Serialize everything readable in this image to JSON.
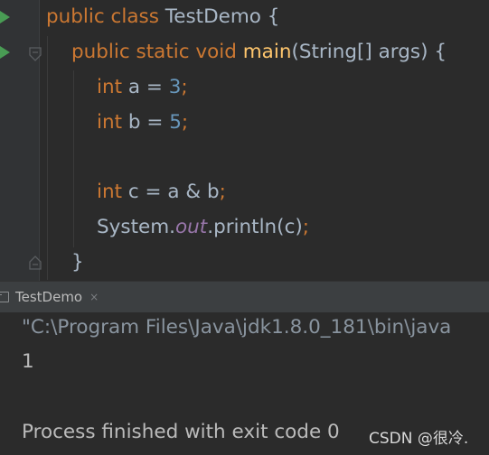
{
  "editor": {
    "lines": [
      {
        "kw1": "public class ",
        "name": "TestDemo {"
      },
      {
        "kw1": "public static void ",
        "fn": "main",
        "rest": "(String[] args) {"
      },
      {
        "kw1": "int ",
        "rest": "a = ",
        "num": "3",
        "punc": ";"
      },
      {
        "kw1": "int ",
        "rest": "b = ",
        "num": "5",
        "punc": ";"
      },
      {
        "kw1": "int ",
        "rest": "c = a & b",
        "punc": ";"
      },
      {
        "a": "System.",
        "fld": "out",
        "b": ".println(c)",
        "punc": ";"
      },
      {
        "rest": "}"
      }
    ]
  },
  "tool_window": {
    "tab_label": "TestDemo",
    "tab_close": "×"
  },
  "console": {
    "command": "\"C:\\Program Files\\Java\\jdk1.8.0_181\\bin\\java",
    "output": "1",
    "finished": "Process finished with exit code 0"
  },
  "watermark": "CSDN @很冷."
}
